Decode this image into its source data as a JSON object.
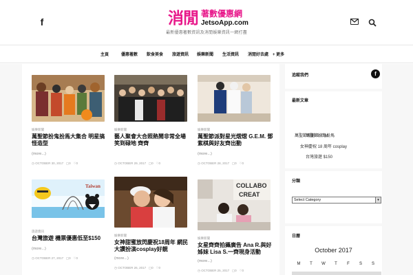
{
  "header": {
    "logo_main": "消閒",
    "logo_sub": "著數優惠網",
    "logo_url": "JetsoApp.com",
    "tagline": "最新優惠著數資訊及消閒娛樂資訊一網打盡"
  },
  "nav": {
    "items": [
      "主頁",
      "優惠著數",
      "飲食美食",
      "旅遊資訊",
      "娛樂新聞",
      "生活資訊",
      "消閒好去處",
      "更多"
    ]
  },
  "posts": [
    {
      "category": "娛樂新聞",
      "title": "萬聖節扮鬼扮馬大集合 明星搞怪造型",
      "more": "(more...)",
      "date": "OCTOBER 30, 2017",
      "comments": "0",
      "likes": "0"
    },
    {
      "category": "娛樂新聞",
      "title": "藝人聚會大合照熱鬧非常全場笑到碌地 齊齊",
      "more": "(more...)",
      "date": "OCTOBER 29, 2017",
      "comments": "0",
      "likes": "0"
    },
    {
      "category": "娛樂新聞",
      "title": "萬聖節派對星光熠熠 G.E.M. 鄧紫棋與好友齊出動",
      "more": "(more...)",
      "date": "OCTOBER 28, 2017",
      "comments": "0",
      "likes": "0"
    },
    {
      "category": "旅遊資訊",
      "title": "台灣旅遊 機票優惠低至$150",
      "more": "(more...)",
      "date": "OCTOBER 27, 2017",
      "comments": "0",
      "likes": "0"
    },
    {
      "category": "娛樂新聞",
      "title": "女神甜蜜放閃慶祝18周年 網民大讚扮演cosplay好靚",
      "more": "(more...)",
      "date": "OCTOBER 26, 2017",
      "comments": "0",
      "likes": "0"
    },
    {
      "category": "娛樂新聞",
      "title": "女星齊齊拍攝廣告 Ana R.與好姊妹 Lisa S.一齊現身活動",
      "more": "(more...)",
      "date": "OCTOBER 25, 2017",
      "comments": "0",
      "likes": "0"
    }
  ],
  "sidebar": {
    "follow_title": "追蹤我們",
    "recent_title": "最新文章",
    "recent_lines": [
      "萬聖節扮鬼扮馬",
      "萬聖節派對 G.E.M.",
      "女神慶祝 18 周年 cosplay",
      "台灣旅遊 $150"
    ],
    "category_title": "分類",
    "select_value": "Select Category",
    "archive_title": "日曆",
    "calendar_month": "October 2017",
    "weekdays": [
      "M",
      "T",
      "W",
      "T",
      "F",
      "S",
      "S"
    ]
  },
  "theme": {
    "brand_pink": "#e8198b",
    "nav_bg": "#ffffff",
    "page_bg": "#f7f7f7"
  }
}
